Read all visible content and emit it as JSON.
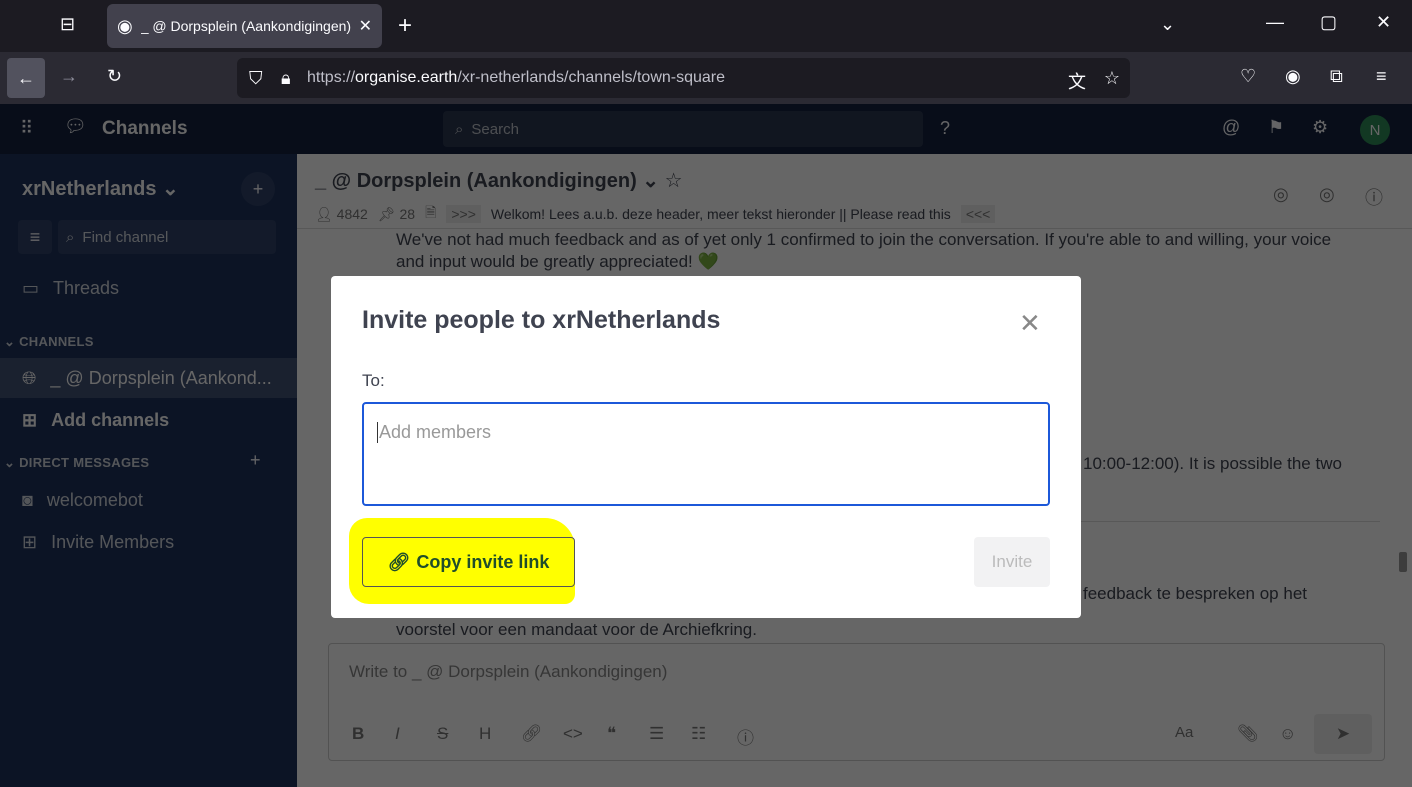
{
  "browser": {
    "tab_title": "_ @ Dorpsplein (Aankondigingen)",
    "url_prefix": "https://",
    "url_domain": "organise.earth",
    "url_path": "/xr-netherlands/channels/town-square"
  },
  "global_header": {
    "product": "Channels",
    "search_placeholder": "Search"
  },
  "sidebar": {
    "team": "xrNetherlands",
    "find_channel": "Find channel",
    "threads": "Threads",
    "channels_header": "CHANNELS",
    "channels": [
      {
        "label": "_ @ Dorpsplein (Aankond..."
      }
    ],
    "add_channels": "Add channels",
    "dm_header": "DIRECT MESSAGES",
    "dms": [
      {
        "label": "welcomebot"
      }
    ],
    "invite_members": "Invite Members"
  },
  "channel": {
    "title": "_ @ Dorpsplein (Aankondigingen)",
    "members": "4842",
    "pinned": "28",
    "header_prefix": ">>>",
    "header_text": "Welkom! Lees a.u.b. deze header, meer tekst hieronder || Please read this",
    "header_suffix": "<<<"
  },
  "messages": [
    "We've not had much feedback and as of yet only 1 confirmed to join the conversation. If you're able to and willing, your voice",
    "and input would be greatly appreciated! 💚",
    "10:00-12:00). It is possible the two",
    "feedback te bespreken op het",
    "voorstel voor een mandaat voor de Archiefkring."
  ],
  "composer": {
    "placeholder": "Write to _ @ Dorpsplein (Aankondigingen)",
    "format_labels": [
      "B",
      "I",
      "S",
      "H"
    ],
    "aa": "Aa"
  },
  "modal": {
    "title": "Invite people to xrNetherlands",
    "to_label": "To:",
    "input_placeholder": "Add members",
    "copy_link": "Copy invite link",
    "invite": "Invite",
    "highlight": "#ffff00"
  },
  "user": {
    "initial": "N"
  }
}
